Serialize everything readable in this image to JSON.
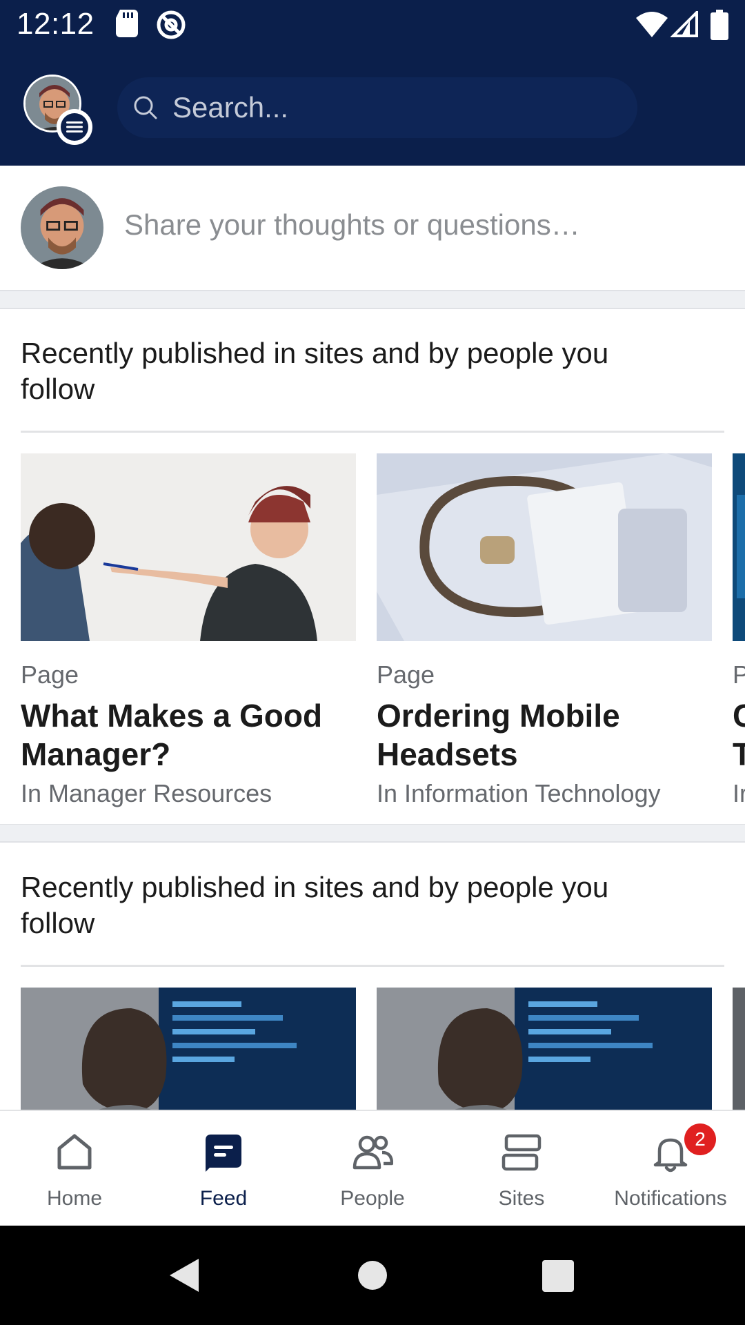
{
  "status_bar": {
    "time": "12:12"
  },
  "search": {
    "placeholder": "Search..."
  },
  "composer": {
    "prompt": "Share your thoughts or questions…"
  },
  "sections": [
    {
      "title": "Recently published in sites and by people you follow",
      "cards": [
        {
          "type": "Page",
          "title": "What Makes a Good Manager?",
          "site": "In Manager Resources",
          "image": "whiteboard-meeting"
        },
        {
          "type": "Page",
          "title": "Ordering Mobile Headsets",
          "site": "In Information Technology",
          "image": "samsung-headset-box"
        },
        {
          "type": "P",
          "title": "C T",
          "site": "Ir"
        }
      ]
    },
    {
      "title": "Recently published in sites and by people you follow",
      "cards": [
        {
          "image": "developer-monitor"
        },
        {
          "image": "developer-monitor"
        }
      ]
    }
  ],
  "bottom_nav": {
    "items": [
      {
        "label": "Home",
        "icon": "home-icon"
      },
      {
        "label": "Feed",
        "icon": "feed-icon",
        "active": true
      },
      {
        "label": "People",
        "icon": "people-icon"
      },
      {
        "label": "Sites",
        "icon": "sites-icon"
      },
      {
        "label": "Notifications",
        "icon": "bell-icon",
        "badge": "2"
      }
    ]
  },
  "colors": {
    "header": "#0b1f4b",
    "badge": "#e02020",
    "active_nav": "#0b1f4b"
  }
}
